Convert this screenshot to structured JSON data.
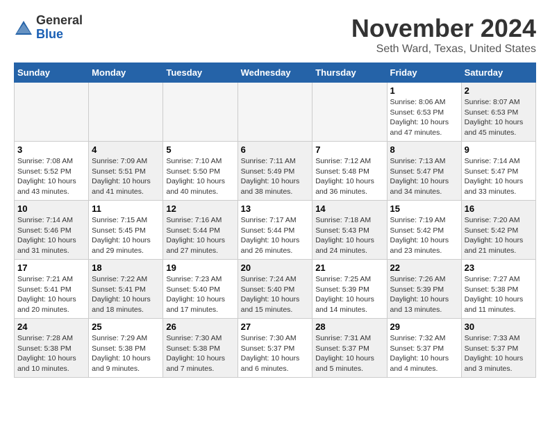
{
  "header": {
    "logo_general": "General",
    "logo_blue": "Blue",
    "month_title": "November 2024",
    "location": "Seth Ward, Texas, United States"
  },
  "days_of_week": [
    "Sunday",
    "Monday",
    "Tuesday",
    "Wednesday",
    "Thursday",
    "Friday",
    "Saturday"
  ],
  "weeks": [
    [
      {
        "day": "",
        "info": "",
        "empty": true
      },
      {
        "day": "",
        "info": "",
        "empty": true
      },
      {
        "day": "",
        "info": "",
        "empty": true
      },
      {
        "day": "",
        "info": "",
        "empty": true
      },
      {
        "day": "",
        "info": "",
        "empty": true
      },
      {
        "day": "1",
        "info": "Sunrise: 8:06 AM\nSunset: 6:53 PM\nDaylight: 10 hours\nand 47 minutes.",
        "shaded": false
      },
      {
        "day": "2",
        "info": "Sunrise: 8:07 AM\nSunset: 6:53 PM\nDaylight: 10 hours\nand 45 minutes.",
        "shaded": true
      }
    ],
    [
      {
        "day": "3",
        "info": "Sunrise: 7:08 AM\nSunset: 5:52 PM\nDaylight: 10 hours\nand 43 minutes.",
        "shaded": false
      },
      {
        "day": "4",
        "info": "Sunrise: 7:09 AM\nSunset: 5:51 PM\nDaylight: 10 hours\nand 41 minutes.",
        "shaded": true
      },
      {
        "day": "5",
        "info": "Sunrise: 7:10 AM\nSunset: 5:50 PM\nDaylight: 10 hours\nand 40 minutes.",
        "shaded": false
      },
      {
        "day": "6",
        "info": "Sunrise: 7:11 AM\nSunset: 5:49 PM\nDaylight: 10 hours\nand 38 minutes.",
        "shaded": true
      },
      {
        "day": "7",
        "info": "Sunrise: 7:12 AM\nSunset: 5:48 PM\nDaylight: 10 hours\nand 36 minutes.",
        "shaded": false
      },
      {
        "day": "8",
        "info": "Sunrise: 7:13 AM\nSunset: 5:47 PM\nDaylight: 10 hours\nand 34 minutes.",
        "shaded": true
      },
      {
        "day": "9",
        "info": "Sunrise: 7:14 AM\nSunset: 5:47 PM\nDaylight: 10 hours\nand 33 minutes.",
        "shaded": false
      }
    ],
    [
      {
        "day": "10",
        "info": "Sunrise: 7:14 AM\nSunset: 5:46 PM\nDaylight: 10 hours\nand 31 minutes.",
        "shaded": true
      },
      {
        "day": "11",
        "info": "Sunrise: 7:15 AM\nSunset: 5:45 PM\nDaylight: 10 hours\nand 29 minutes.",
        "shaded": false
      },
      {
        "day": "12",
        "info": "Sunrise: 7:16 AM\nSunset: 5:44 PM\nDaylight: 10 hours\nand 27 minutes.",
        "shaded": true
      },
      {
        "day": "13",
        "info": "Sunrise: 7:17 AM\nSunset: 5:44 PM\nDaylight: 10 hours\nand 26 minutes.",
        "shaded": false
      },
      {
        "day": "14",
        "info": "Sunrise: 7:18 AM\nSunset: 5:43 PM\nDaylight: 10 hours\nand 24 minutes.",
        "shaded": true
      },
      {
        "day": "15",
        "info": "Sunrise: 7:19 AM\nSunset: 5:42 PM\nDaylight: 10 hours\nand 23 minutes.",
        "shaded": false
      },
      {
        "day": "16",
        "info": "Sunrise: 7:20 AM\nSunset: 5:42 PM\nDaylight: 10 hours\nand 21 minutes.",
        "shaded": true
      }
    ],
    [
      {
        "day": "17",
        "info": "Sunrise: 7:21 AM\nSunset: 5:41 PM\nDaylight: 10 hours\nand 20 minutes.",
        "shaded": false
      },
      {
        "day": "18",
        "info": "Sunrise: 7:22 AM\nSunset: 5:41 PM\nDaylight: 10 hours\nand 18 minutes.",
        "shaded": true
      },
      {
        "day": "19",
        "info": "Sunrise: 7:23 AM\nSunset: 5:40 PM\nDaylight: 10 hours\nand 17 minutes.",
        "shaded": false
      },
      {
        "day": "20",
        "info": "Sunrise: 7:24 AM\nSunset: 5:40 PM\nDaylight: 10 hours\nand 15 minutes.",
        "shaded": true
      },
      {
        "day": "21",
        "info": "Sunrise: 7:25 AM\nSunset: 5:39 PM\nDaylight: 10 hours\nand 14 minutes.",
        "shaded": false
      },
      {
        "day": "22",
        "info": "Sunrise: 7:26 AM\nSunset: 5:39 PM\nDaylight: 10 hours\nand 13 minutes.",
        "shaded": true
      },
      {
        "day": "23",
        "info": "Sunrise: 7:27 AM\nSunset: 5:38 PM\nDaylight: 10 hours\nand 11 minutes.",
        "shaded": false
      }
    ],
    [
      {
        "day": "24",
        "info": "Sunrise: 7:28 AM\nSunset: 5:38 PM\nDaylight: 10 hours\nand 10 minutes.",
        "shaded": true
      },
      {
        "day": "25",
        "info": "Sunrise: 7:29 AM\nSunset: 5:38 PM\nDaylight: 10 hours\nand 9 minutes.",
        "shaded": false
      },
      {
        "day": "26",
        "info": "Sunrise: 7:30 AM\nSunset: 5:38 PM\nDaylight: 10 hours\nand 7 minutes.",
        "shaded": true
      },
      {
        "day": "27",
        "info": "Sunrise: 7:30 AM\nSunset: 5:37 PM\nDaylight: 10 hours\nand 6 minutes.",
        "shaded": false
      },
      {
        "day": "28",
        "info": "Sunrise: 7:31 AM\nSunset: 5:37 PM\nDaylight: 10 hours\nand 5 minutes.",
        "shaded": true
      },
      {
        "day": "29",
        "info": "Sunrise: 7:32 AM\nSunset: 5:37 PM\nDaylight: 10 hours\nand 4 minutes.",
        "shaded": false
      },
      {
        "day": "30",
        "info": "Sunrise: 7:33 AM\nSunset: 5:37 PM\nDaylight: 10 hours\nand 3 minutes.",
        "shaded": true
      }
    ]
  ]
}
